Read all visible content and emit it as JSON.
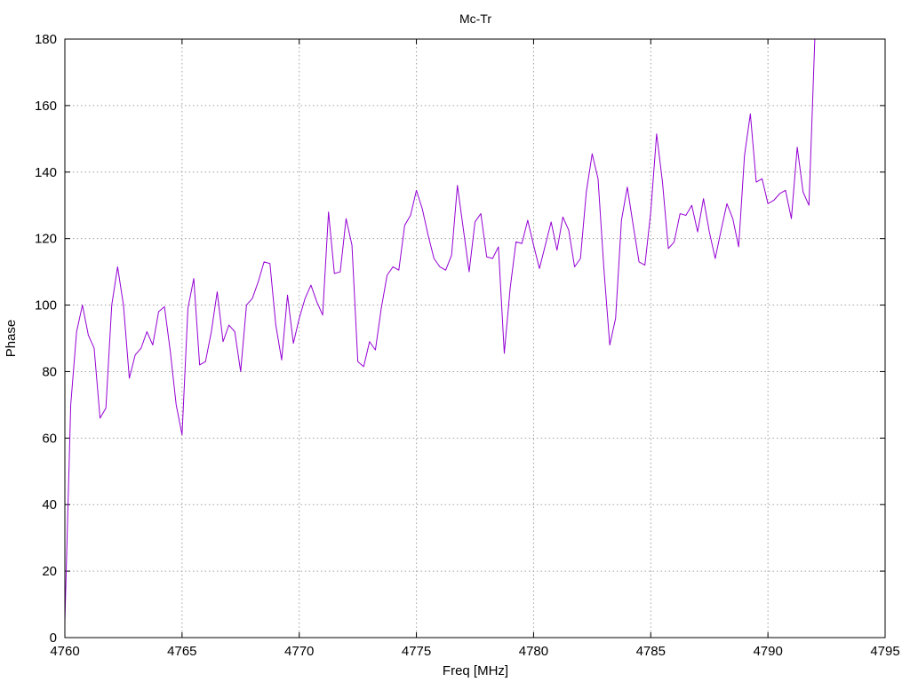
{
  "chart_data": {
    "type": "line",
    "title": "Mc-Tr",
    "xlabel": "Freq [MHz]",
    "ylabel": "Phase",
    "xlim": [
      4760,
      4795
    ],
    "ylim": [
      0,
      180
    ],
    "xticks": [
      4760,
      4765,
      4770,
      4775,
      4780,
      4785,
      4790,
      4795
    ],
    "yticks": [
      0,
      20,
      40,
      60,
      80,
      100,
      120,
      140,
      160,
      180
    ],
    "grid": true,
    "legend": "none",
    "series": [
      {
        "color": "#9400d3",
        "x": [
          4760.0,
          4760.25,
          4760.5,
          4760.75,
          4761.0,
          4761.25,
          4761.5,
          4761.75,
          4762.0,
          4762.25,
          4762.5,
          4762.75,
          4763.0,
          4763.25,
          4763.5,
          4763.75,
          4764.0,
          4764.25,
          4764.5,
          4764.75,
          4765.0,
          4765.25,
          4765.5,
          4765.75,
          4766.0,
          4766.25,
          4766.5,
          4766.75,
          4767.0,
          4767.25,
          4767.5,
          4767.75,
          4768.0,
          4768.25,
          4768.5,
          4768.75,
          4769.0,
          4769.25,
          4769.5,
          4769.75,
          4770.0,
          4770.25,
          4770.5,
          4770.75,
          4771.0,
          4771.25,
          4771.5,
          4771.75,
          4772.0,
          4772.25,
          4772.5,
          4772.75,
          4773.0,
          4773.25,
          4773.5,
          4773.75,
          4774.0,
          4774.25,
          4774.5,
          4774.75,
          4775.0,
          4775.25,
          4775.5,
          4775.75,
          4776.0,
          4776.25,
          4776.5,
          4776.75,
          4777.0,
          4777.25,
          4777.5,
          4777.75,
          4778.0,
          4778.25,
          4778.5,
          4778.75,
          4779.0,
          4779.25,
          4779.5,
          4779.75,
          4780.0,
          4780.25,
          4780.5,
          4780.75,
          4781.0,
          4781.25,
          4781.5,
          4781.75,
          4782.0,
          4782.25,
          4782.5,
          4782.75,
          4783.0,
          4783.25,
          4783.5,
          4783.75,
          4784.0,
          4784.25,
          4784.5,
          4784.75,
          4785.0,
          4785.25,
          4785.5,
          4785.75,
          4786.0,
          4786.25,
          4786.5,
          4786.75,
          4787.0,
          4787.25,
          4787.5,
          4787.75,
          4788.0,
          4788.25,
          4788.5,
          4788.75,
          4789.0,
          4789.25,
          4789.5,
          4789.75,
          4790.0,
          4790.25,
          4790.5,
          4790.75,
          4791.0,
          4791.25,
          4791.5,
          4791.75,
          4792.0
        ],
        "values": [
          5,
          70,
          92,
          100,
          91,
          87,
          66,
          69,
          100,
          111.5,
          100,
          78,
          85,
          87,
          92,
          88,
          98,
          99.5,
          86,
          70,
          61,
          99,
          108,
          82,
          83,
          92,
          104,
          89,
          94,
          92,
          80,
          100,
          102,
          107,
          113,
          112.5,
          94,
          83.5,
          103,
          88.5,
          96,
          102,
          106,
          101,
          97,
          128,
          109.5,
          110,
          126,
          118,
          83,
          81.5,
          89,
          86.5,
          99,
          109,
          111.5,
          110.5,
          124,
          127,
          134.5,
          129,
          121,
          114,
          111.5,
          110.5,
          115,
          136,
          123,
          110,
          125,
          127.5,
          114.5,
          114,
          117.5,
          85.5,
          105,
          119,
          118.5,
          125.5,
          118,
          111,
          118,
          125,
          116.5,
          126.5,
          122.5,
          111.5,
          114,
          134,
          145.5,
          138,
          111,
          88,
          96,
          125.5,
          135.5,
          124,
          113,
          112,
          128,
          151.5,
          137,
          117,
          119,
          127.5,
          127,
          130,
          122,
          132,
          122,
          114,
          122.5,
          130.5,
          126,
          117.5,
          145,
          157.5,
          137,
          138,
          130.5,
          131.5,
          133.5,
          134.5,
          126,
          147.5,
          134,
          130,
          180
        ]
      }
    ]
  }
}
